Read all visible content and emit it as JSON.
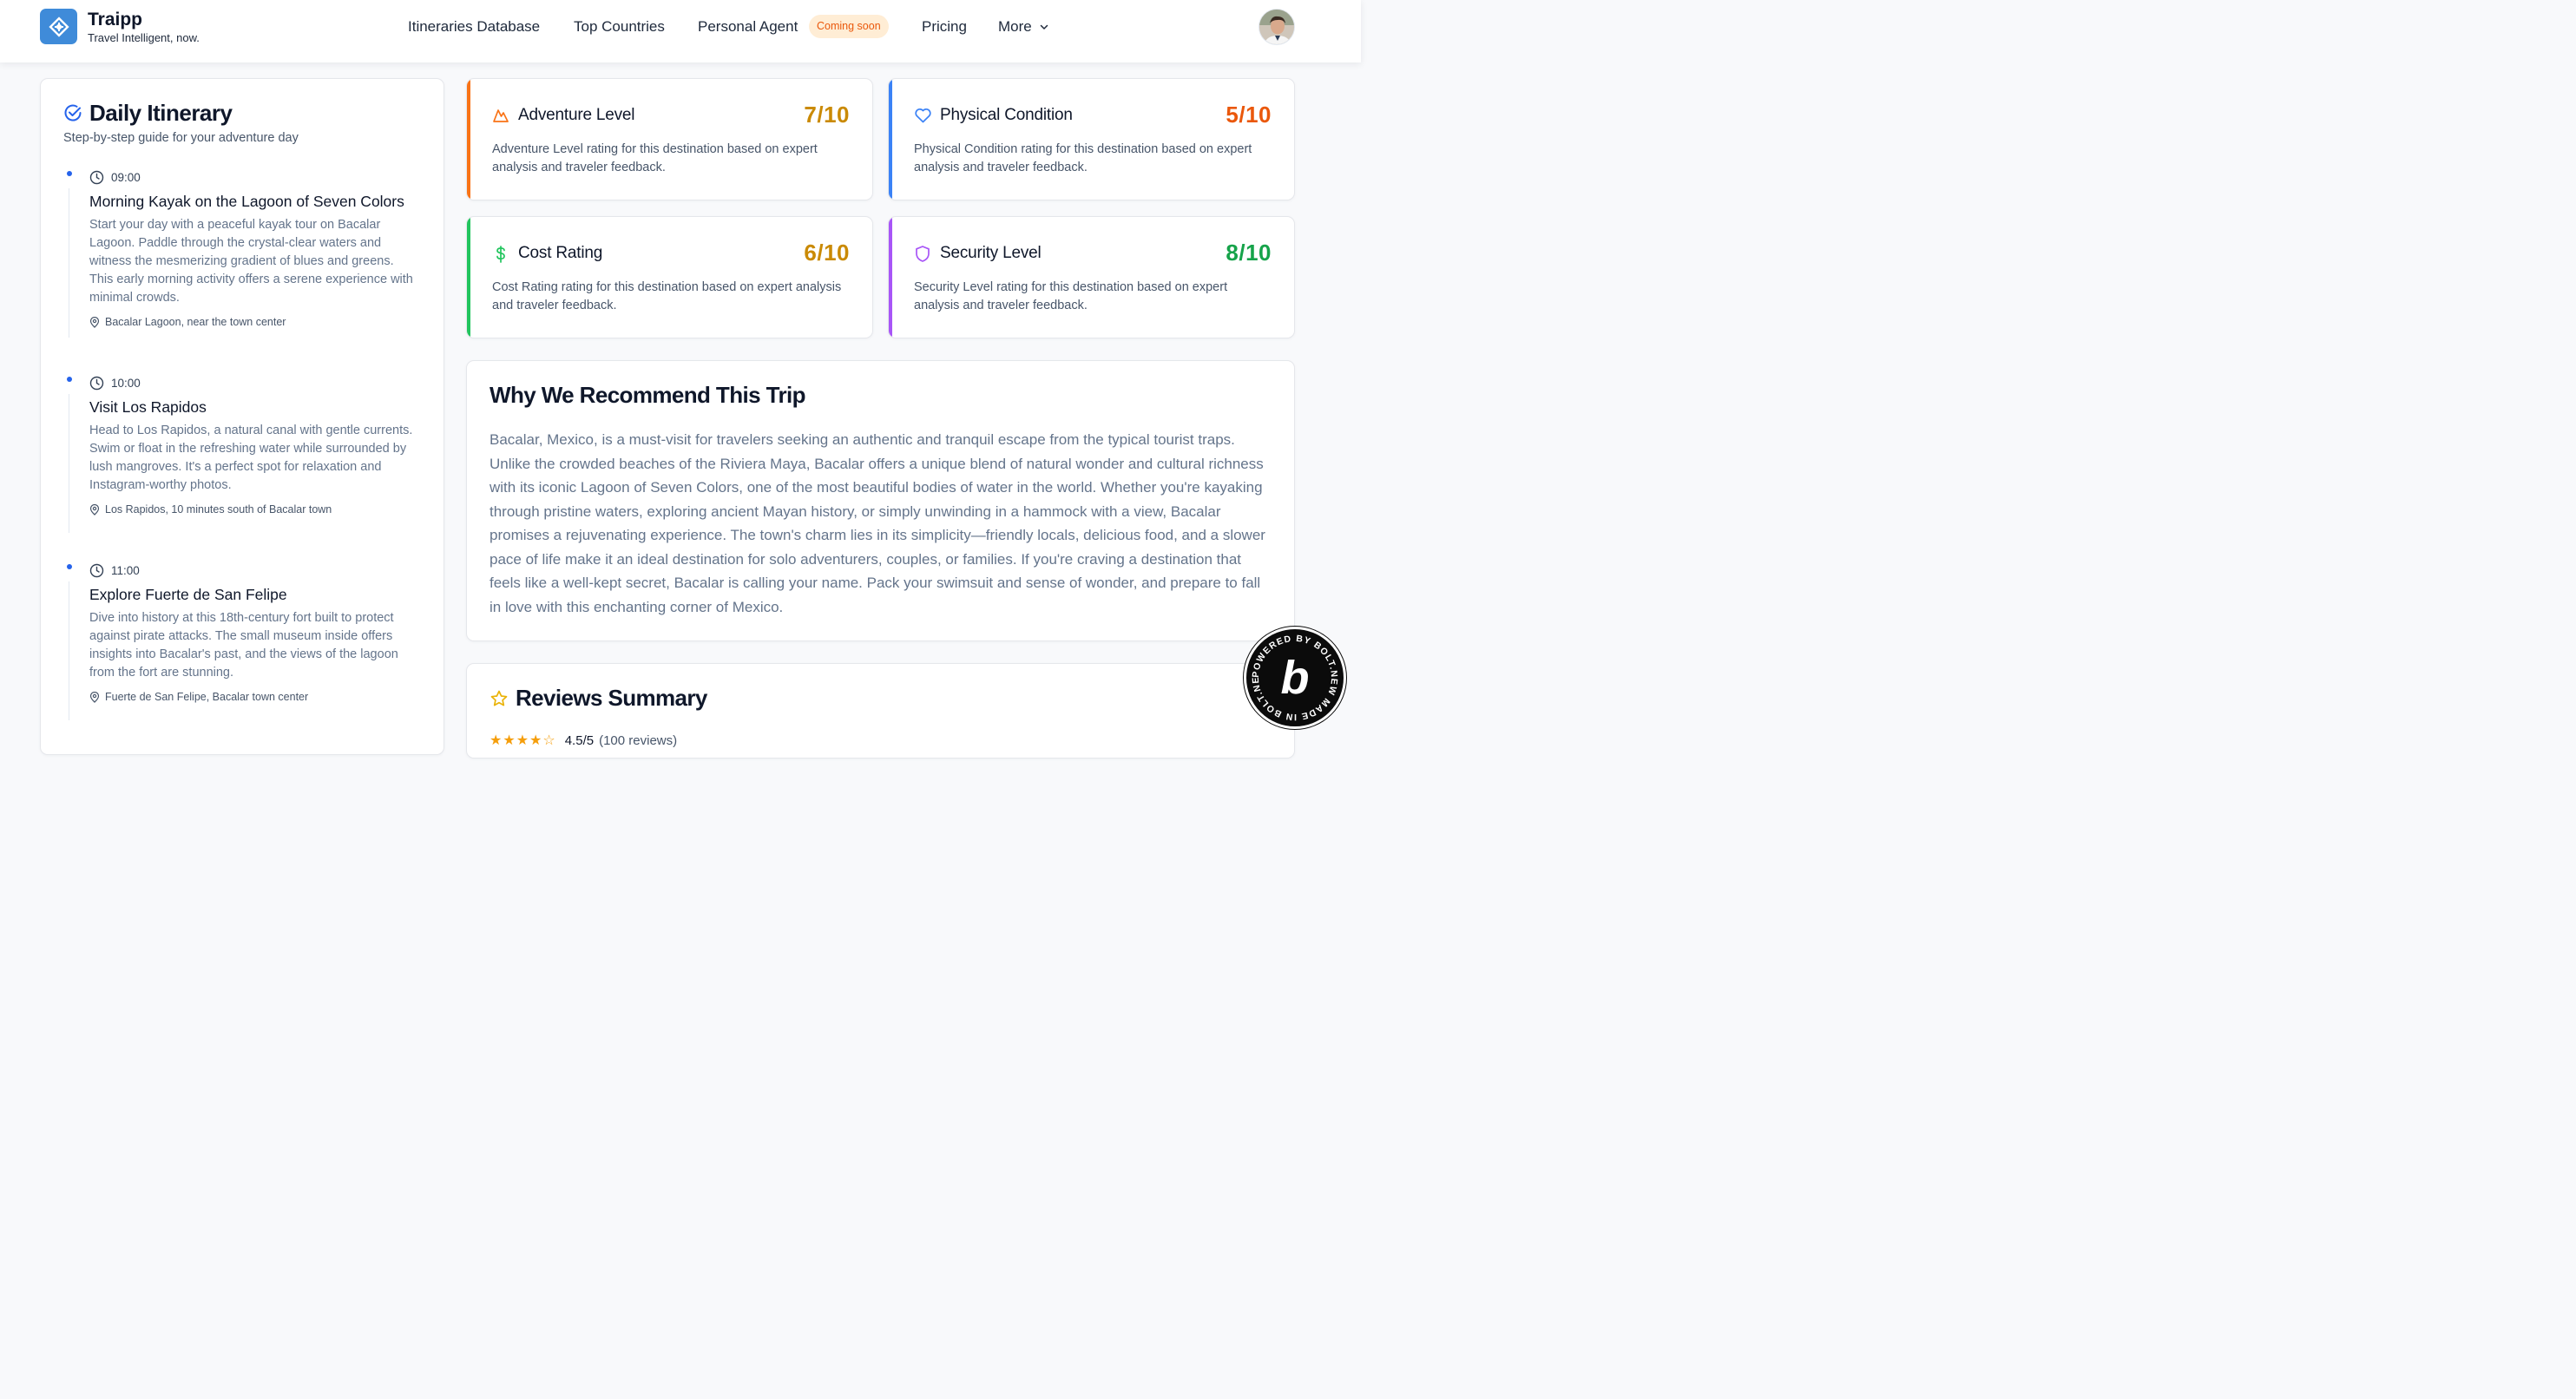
{
  "header": {
    "brand_name": "Traipp",
    "brand_tagline": "Travel Intelligent, now.",
    "nav": {
      "itineraries": "Itineraries Database",
      "countries": "Top Countries",
      "agent": "Personal Agent",
      "agent_badge": "Coming soon",
      "pricing": "Pricing",
      "more": "More"
    }
  },
  "itinerary": {
    "title": "Daily Itinerary",
    "subtitle": "Step-by-step guide for your adventure day",
    "items": [
      {
        "time": "09:00",
        "title": "Morning Kayak on the Lagoon of Seven Colors",
        "description": "Start your day with a peaceful kayak tour on Bacalar Lagoon. Paddle through the crystal-clear waters and witness the mesmerizing gradient of blues and greens. This early morning activity offers a serene experience with minimal crowds.",
        "location": "Bacalar Lagoon, near the town center"
      },
      {
        "time": "10:00",
        "title": "Visit Los Rapidos",
        "description": "Head to Los Rapidos, a natural canal with gentle currents. Swim or float in the refreshing water while surrounded by lush mangroves. It's a perfect spot for relaxation and Instagram-worthy photos.",
        "location": "Los Rapidos, 10 minutes south of Bacalar town"
      },
      {
        "time": "11:00",
        "title": "Explore Fuerte de San Felipe",
        "description": "Dive into history at this 18th-century fort built to protect against pirate attacks. The small museum inside offers insights into Bacalar's past, and the views of the lagoon from the fort are stunning.",
        "location": "Fuerte de San Felipe, Bacalar town center"
      }
    ]
  },
  "metrics": [
    {
      "title": "Adventure Level",
      "score": "7/10",
      "description": "Adventure Level rating for this destination based on expert analysis and traveler feedback.",
      "color": "#f97316",
      "score_color": "#ca8a04",
      "icon": "mountain-icon"
    },
    {
      "title": "Physical Condition",
      "score": "5/10",
      "description": "Physical Condition rating for this destination based on expert analysis and traveler feedback.",
      "color": "#3b82f6",
      "score_color": "#ea580c",
      "icon": "heart-icon"
    },
    {
      "title": "Cost Rating",
      "score": "6/10",
      "description": "Cost Rating rating for this destination based on expert analysis and traveler feedback.",
      "color": "#22c55e",
      "score_color": "#ca8a04",
      "icon": "dollar-icon"
    },
    {
      "title": "Security Level",
      "score": "8/10",
      "description": "Security Level rating for this destination based on expert analysis and traveler feedback.",
      "color": "#a855f7",
      "score_color": "#16a34a",
      "icon": "shield-icon"
    }
  ],
  "recommend": {
    "title": "Why We Recommend This Trip",
    "body": "Bacalar, Mexico, is a must-visit for travelers seeking an authentic and tranquil escape from the typical tourist traps. Unlike the crowded beaches of the Riviera Maya, Bacalar offers a unique blend of natural wonder and cultural richness with its iconic Lagoon of Seven Colors, one of the most beautiful bodies of water in the world. Whether you're kayaking through pristine waters, exploring ancient Mayan history, or simply unwinding in a hammock with a view, Bacalar promises a rejuvenating experience. The town's charm lies in its simplicity—friendly locals, delicious food, and a slower pace of life make it an ideal destination for solo adventurers, couples, or families. If you're craving a destination that feels like a well-kept secret, Bacalar is calling your name. Pack your swimsuit and sense of wonder, and prepare to fall in love with this enchanting corner of Mexico."
  },
  "reviews": {
    "title": "Reviews Summary",
    "stars": "★★★★☆",
    "score": "4.5/5",
    "count": "(100 reviews)"
  },
  "bolt_badge": {
    "text": "POWERED BY BOLT.NEW MADE IN BOLT.NEW ",
    "letter": "b"
  }
}
